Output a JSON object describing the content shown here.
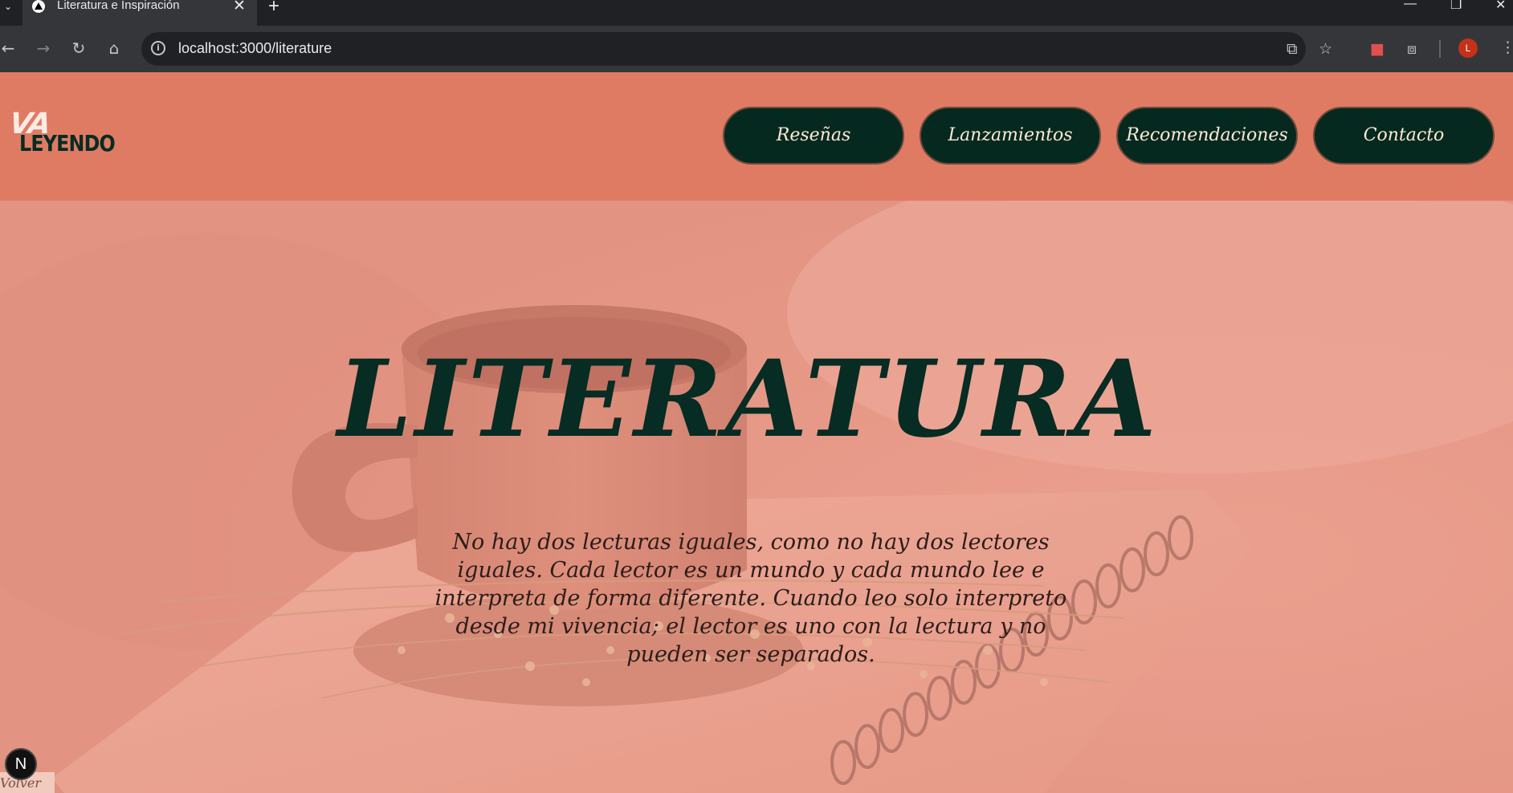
{
  "browser": {
    "tab_title": "Literatura e Inspiración",
    "tab_list_icon": "chevron-down-icon",
    "new_tab_symbol": "+",
    "close_symbol": "✕",
    "url": "localhost:3000/literature",
    "avatar_letter": "L",
    "window_controls": {
      "minimize": "—",
      "restore": "❐",
      "close": "✕"
    }
  },
  "header": {
    "logo": {
      "line1": "VA",
      "line2": "LEYENDO"
    },
    "nav": [
      {
        "label": "Reseñas"
      },
      {
        "label": "Lanzamientos"
      },
      {
        "label": "Recomendaciones"
      },
      {
        "label": "Contacto"
      }
    ]
  },
  "hero": {
    "title": "LITERATURA",
    "quote": "No hay dos lecturas iguales, como no hay dos lectores iguales. Cada lector es un mundo y cada mundo lee e interpreta de forma diferente. Cuando leo solo interpreto desde mi vivencia; el lector es uno con la lectura y no pueden ser separados."
  },
  "footer": {
    "dev_badge": "N",
    "back_link": "Volver"
  },
  "colors": {
    "header_bg": "#e07b63",
    "nav_button_bg": "#05291f",
    "nav_button_text": "#ffe9d6",
    "title_color": "#062c24"
  }
}
